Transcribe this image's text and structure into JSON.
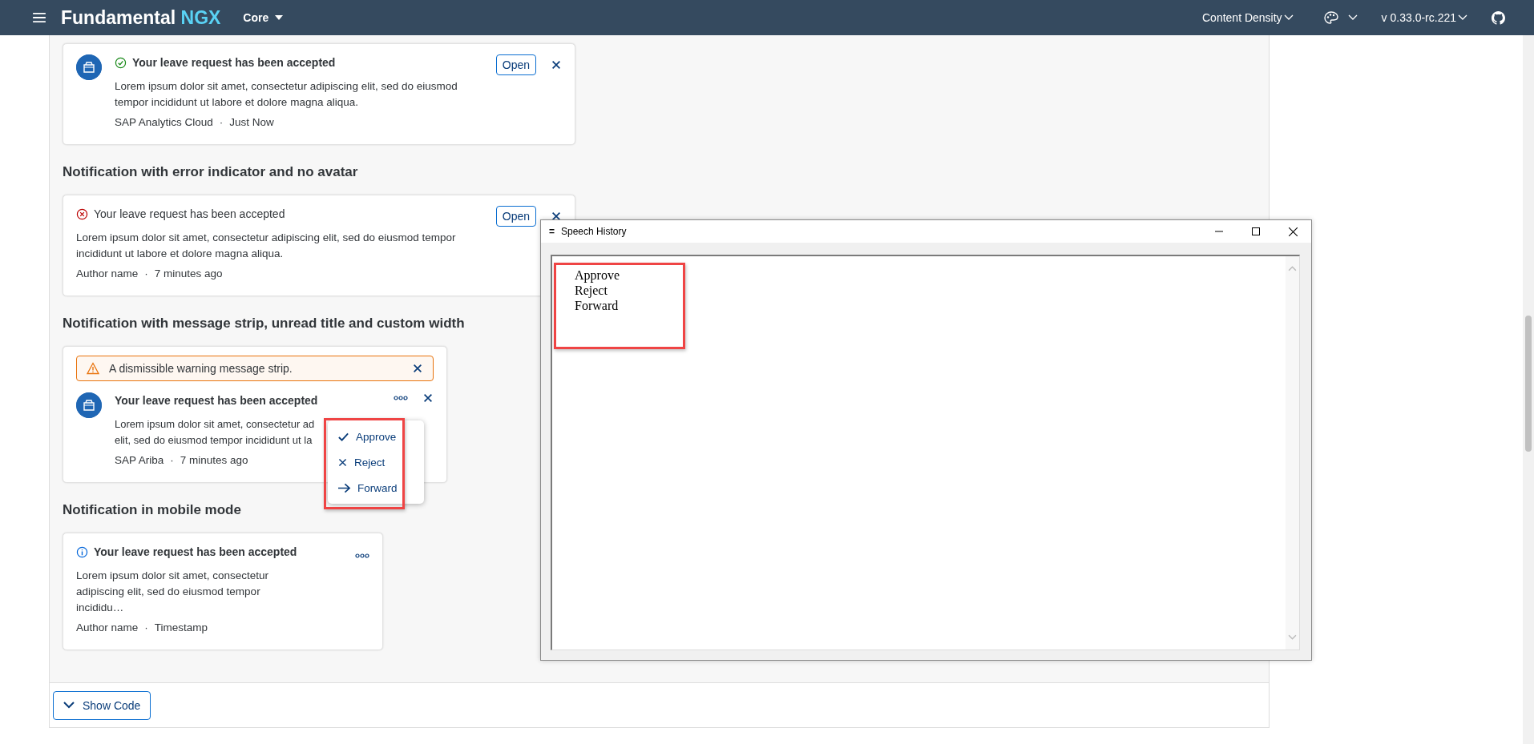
{
  "header": {
    "title": "Fundamental",
    "title_accent": "NGX",
    "product": "Core",
    "content_density": "Content Density",
    "version": "v 0.33.0-rc.221"
  },
  "sections": [
    {
      "notification": {
        "kind": "success",
        "avatar": true,
        "unread": true,
        "title": "Your leave request has been accepted",
        "body": "Lorem ipsum dolor sit amet, consectetur adipiscing elit, sed do eiusmod tempor incididunt ut labore et dolore magna aliqua.",
        "author": "SAP Analytics Cloud",
        "separator": "·",
        "time": "Just Now",
        "action": "Open",
        "closable": true,
        "overflow": false
      }
    },
    {
      "heading": "Notification with error indicator and no avatar",
      "notification": {
        "kind": "error",
        "avatar": false,
        "unread": false,
        "title": "Your leave request has been accepted",
        "body": "Lorem ipsum dolor sit amet, consectetur adipiscing elit, sed do eiusmod tempor incididunt ut labore et dolore magna aliqua.",
        "author": "Author name",
        "separator": "·",
        "time": "7 minutes ago",
        "action": "Open",
        "closable": true,
        "overflow": false
      }
    },
    {
      "heading": "Notification with message strip, unread title and custom width",
      "notification": {
        "kind": "plain",
        "avatar": true,
        "unread": true,
        "strip": "A dismissible warning message strip.",
        "title": "Your leave request has been accepted",
        "body_lines": [
          "Lorem ipsum dolor sit amet, consectetur ad",
          "elit, sed do eiusmod tempor incididunt ut la"
        ],
        "author": "SAP Ariba",
        "separator": "·",
        "time": "7 minutes ago",
        "closable": true,
        "overflow": true,
        "menu": [
          {
            "kind": "approve",
            "label": "Approve"
          },
          {
            "kind": "reject",
            "label": "Reject"
          },
          {
            "kind": "forward",
            "label": "Forward"
          }
        ]
      }
    },
    {
      "heading": "Notification in mobile mode",
      "notification": {
        "kind": "info",
        "avatar": false,
        "unread": true,
        "title": "Your leave request has been accepted",
        "body": "Lorem ipsum dolor sit amet, consectetur adipiscing elit, sed do eiusmod tempor incididu…",
        "author": "Author name",
        "separator": "·",
        "time": "Timestamp",
        "closable": false,
        "overflow": true
      }
    }
  ],
  "show_code": "Show Code",
  "speech_window": {
    "menu_glyph": "=",
    "title": "Speech History",
    "lines": [
      "Approve",
      "Reject",
      "Forward"
    ]
  }
}
